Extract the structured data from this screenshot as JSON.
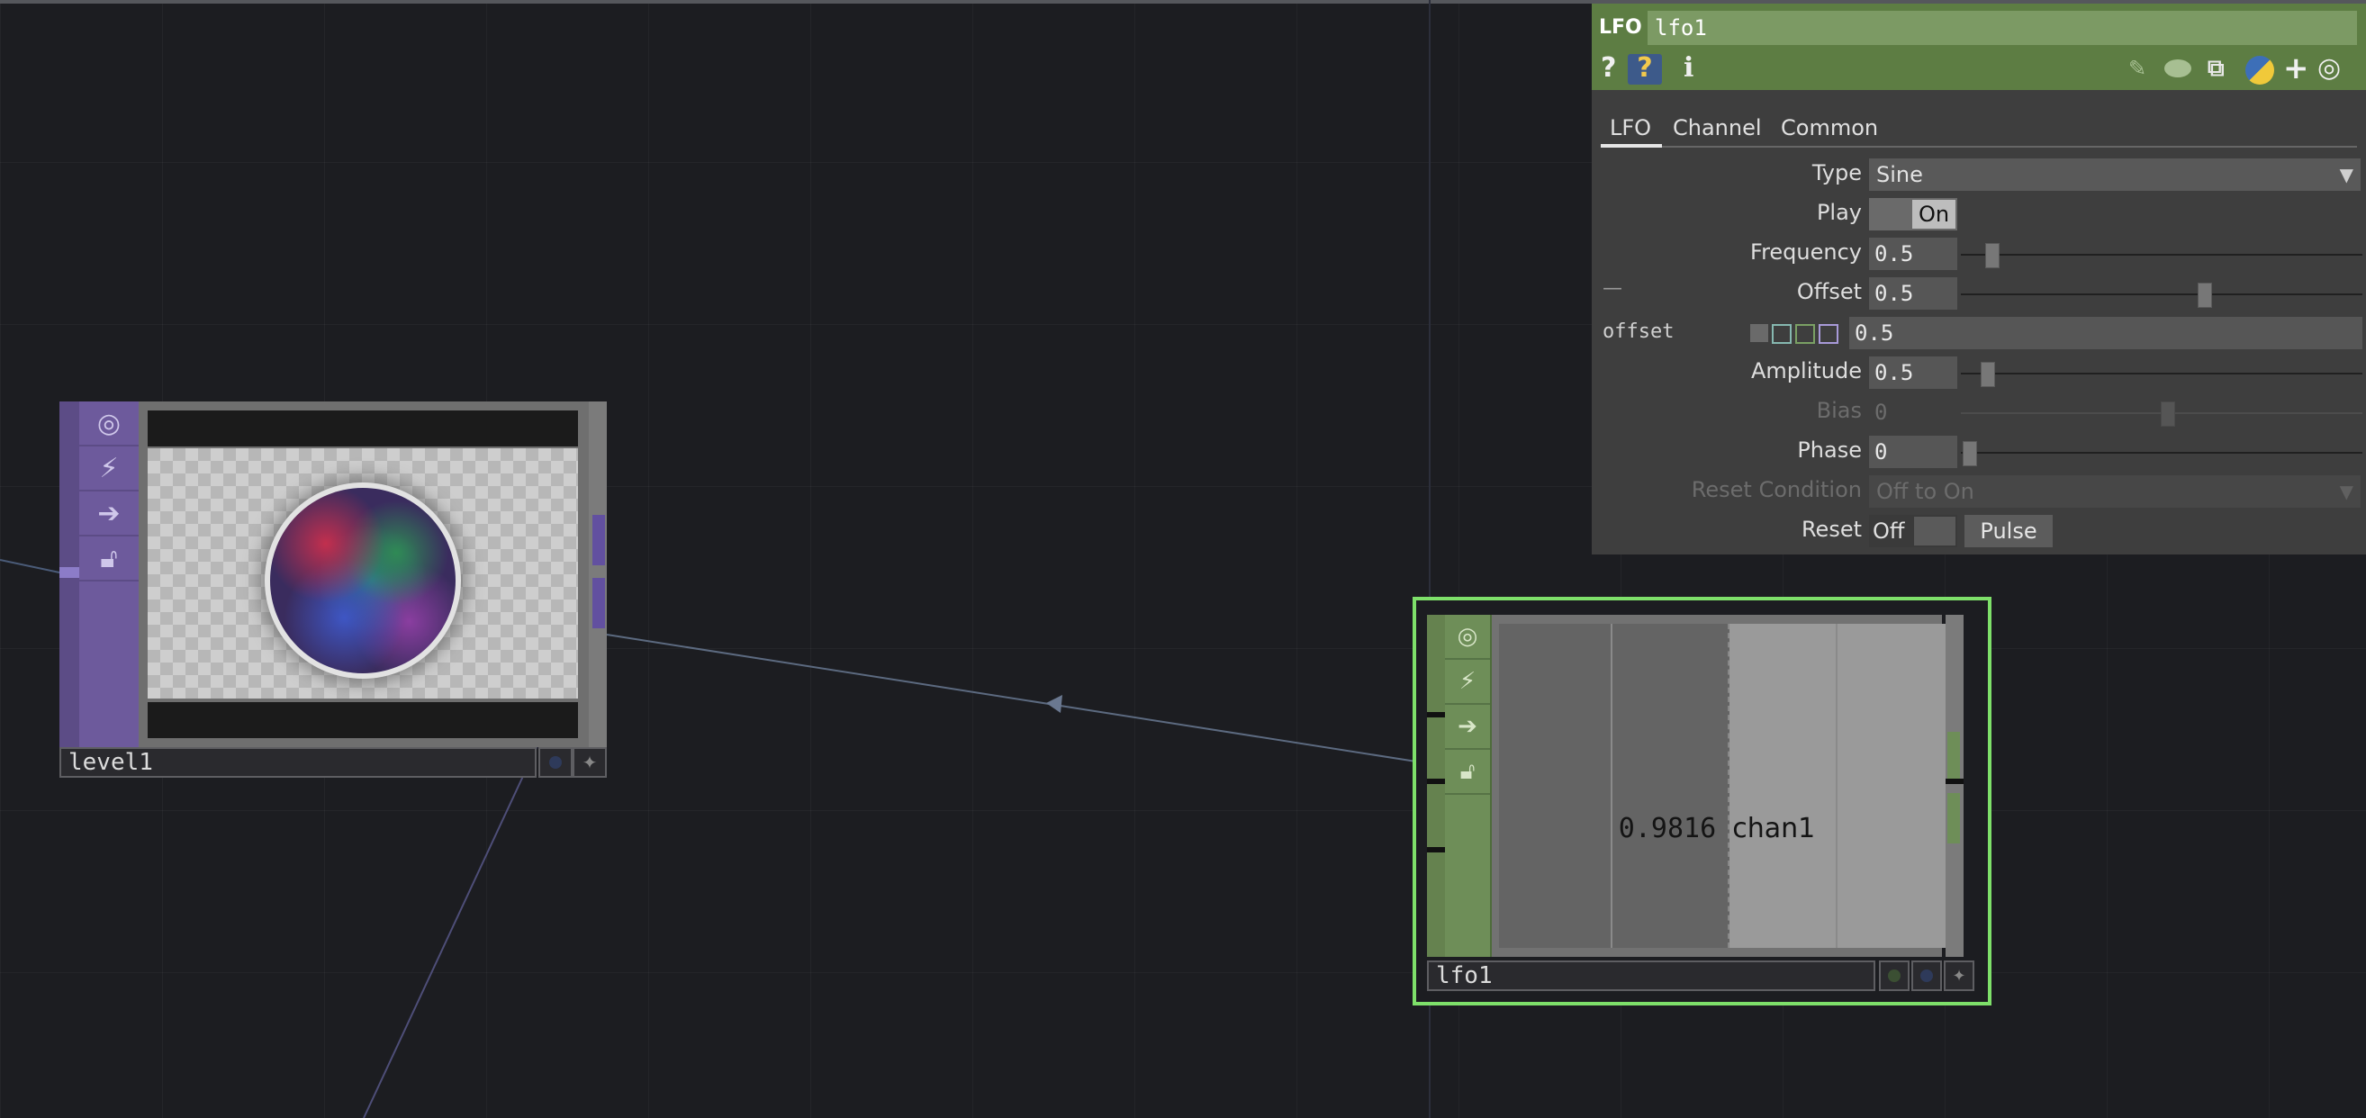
{
  "network": {
    "level_node": {
      "name": "level1"
    },
    "lfo_node": {
      "name": "lfo1",
      "value": "0.9816",
      "channel": "chan1"
    }
  },
  "panel": {
    "op_type": "LFO",
    "op_name": "lfo1",
    "header_icons": [
      "help-icon",
      "python-help-icon",
      "info-icon",
      "edit-icon",
      "comment-icon",
      "clone-icon",
      "python-icon",
      "add-icon",
      "viewer-icon"
    ],
    "help_glyph": "?",
    "info_glyph": "i",
    "tabs": [
      "LFO",
      "Channel",
      "Common"
    ],
    "active_tab": "LFO",
    "params": {
      "type": {
        "label": "Type",
        "value": "Sine"
      },
      "play": {
        "label": "Play",
        "value": "On"
      },
      "frequency": {
        "label": "Frequency",
        "value": "0.5",
        "slider": 0.05
      },
      "offset": {
        "label": "Offset",
        "value": "0.5",
        "slider": 0.62
      },
      "offset_expanded": {
        "label": "offset",
        "value": "0.5"
      },
      "amplitude": {
        "label": "Amplitude",
        "value": "0.5",
        "slider": 0.04
      },
      "bias": {
        "label": "Bias",
        "value": "0",
        "slider": 0.58
      },
      "phase": {
        "label": "Phase",
        "value": "0",
        "slider": 0.0
      },
      "reset_condition": {
        "label": "Reset Condition",
        "value": "Off to On"
      },
      "reset": {
        "label": "Reset",
        "value": "Off",
        "pulse": "Pulse"
      }
    },
    "collapse_glyph": "—"
  },
  "colors": {
    "top_operator": "#6d5a9c",
    "chop_operator": "#6e8e58",
    "selected_outline": "#7ee06a",
    "panel_header": "#5d7d43"
  }
}
